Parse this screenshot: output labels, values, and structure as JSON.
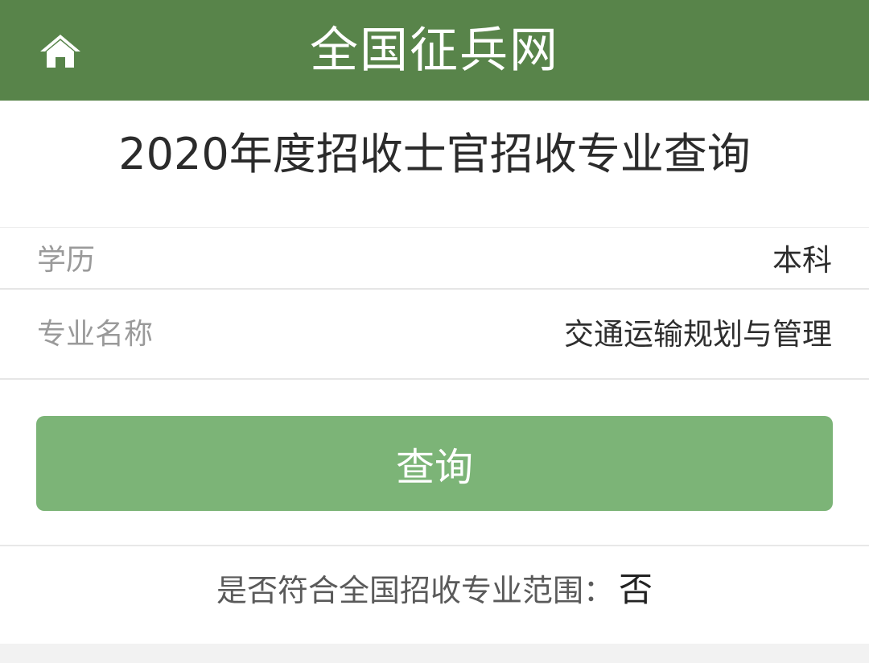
{
  "header": {
    "title": "全国征兵网",
    "home_icon": "home-icon",
    "background_color": "#58844a"
  },
  "page": {
    "title": "2020年度招收士官招收专业查询"
  },
  "form": {
    "education": {
      "label": "学历",
      "value": "本科"
    },
    "major": {
      "label": "专业名称",
      "value": "交通运输规划与管理"
    }
  },
  "query_button": {
    "label": "查询",
    "color": "#7cb477"
  },
  "result": {
    "label": "是否符合全国招收专业范围：",
    "value": "否"
  }
}
